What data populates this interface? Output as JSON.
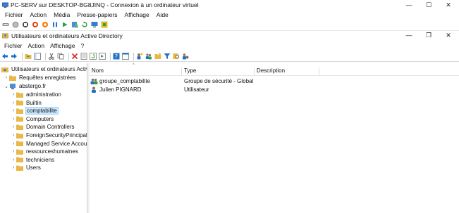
{
  "vm_window": {
    "title": "PC-SERV sur DESKTOP-BG8JINQ - Connexion à un ordinateur virtuel",
    "controls": {
      "minimize": "—",
      "maximize": "☐",
      "close": "✕"
    },
    "menu": [
      "Fichier",
      "Action",
      "Média",
      "Presse-papiers",
      "Affichage",
      "Aide"
    ]
  },
  "vm_toolbar_icons": [
    "ctrl-alt-del-icon",
    "start-icon",
    "turn-off-icon",
    "shut-down-icon",
    "save-icon",
    "pause-icon",
    "resume-icon",
    "checkpoint-icon",
    "revert-icon",
    "enhanced-session-icon",
    "share-icon"
  ],
  "mmc_window": {
    "title": "Utilisateurs et ordinateurs Active Directory",
    "controls": {
      "minimize": "—",
      "restore": "❐",
      "close": "✕"
    },
    "menu": [
      "Fichier",
      "Action",
      "Affichage",
      "?"
    ]
  },
  "mmc_toolbar_icons": [
    "back-icon",
    "forward-icon",
    "up-folder-icon",
    "show-tree-icon",
    "cut-icon",
    "copy-icon",
    "delete-icon",
    "properties-icon",
    "refresh-icon",
    "export-icon",
    "help-icon",
    "console-icon",
    "new-user-icon",
    "new-group-icon",
    "new-ou-icon",
    "filter-icon",
    "find-icon",
    "add-to-group-icon"
  ],
  "tree": {
    "root": "Utilisateurs et ordinateurs Active Directory",
    "saved_queries": "Requêtes enregistrées",
    "domain": "abstergo.fr",
    "children": [
      "administration",
      "Builtin",
      "comptabilite",
      "Computers",
      "Domain Controllers",
      "ForeignSecurityPrincipals",
      "Managed Service Accounts",
      "ressourceshumaines",
      "techniciens",
      "Users"
    ],
    "selected": "comptabilite"
  },
  "list": {
    "columns": [
      "Nom",
      "Type",
      "Description"
    ],
    "rows": [
      {
        "name": "groupe_comptabilite",
        "type": "Groupe de sécurité - Global",
        "description": "",
        "icon": "group-icon"
      },
      {
        "name": "Julien PIGNARD",
        "type": "Utilisateur",
        "description": "",
        "icon": "user-icon"
      }
    ]
  },
  "colors": {
    "folder": "#e8b84a",
    "selection": "#cce8ff",
    "accent": "#1e73c8"
  }
}
